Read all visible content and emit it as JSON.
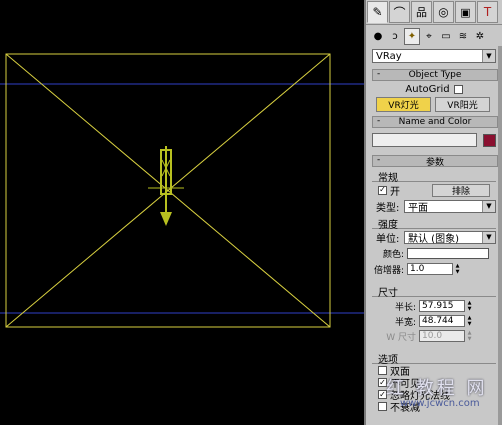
{
  "viewport": {
    "label": "viewport"
  },
  "panel": {
    "tabs": [
      "create-tab",
      "modify-tab",
      "hierarchy-tab",
      "motion-tab",
      "display-tab",
      "utilities-tab"
    ],
    "subtabs": [
      "geometry-icon",
      "shapes-icon",
      "lights-icon",
      "cameras-icon",
      "helpers-icon",
      "spacewarps-icon",
      "systems-icon"
    ],
    "category": "VRay",
    "object_type": {
      "title": "Object Type",
      "sign": "-",
      "autogrid_label": "AutoGrid",
      "buttons": [
        "VR灯光",
        "VR阳光"
      ]
    },
    "name_color": {
      "title": "Name and Color",
      "sign": "-",
      "name_value": "",
      "color": "#8a1030"
    },
    "params": {
      "title": "参数",
      "sign": "-",
      "general": {
        "title": "常规",
        "on_label": "开",
        "on_checked": "✓",
        "exclude_label": "排除",
        "type_label": "类型:",
        "type_value": "平面"
      },
      "intensity": {
        "title": "强度",
        "units_label": "单位:",
        "units_value": "默认 (图象)",
        "color_label": "颜色:",
        "multiplier_label": "倍增器:",
        "multiplier_value": "1.0"
      },
      "size": {
        "title": "尺寸",
        "half_length_label": "半长:",
        "half_length_value": "57.915",
        "half_width_label": "半宽:",
        "half_width_value": "48.744",
        "w_size_label": "W 尺寸",
        "w_size_value": "10.0"
      },
      "options": {
        "title": "选项",
        "items": [
          {
            "checked": "",
            "label": "双面"
          },
          {
            "checked": "✓",
            "label": "不可见"
          },
          {
            "checked": "✓",
            "label": "忽略灯光法线"
          },
          {
            "checked": "",
            "label": "不衰减"
          }
        ]
      }
    }
  },
  "watermark": {
    "title": "红 教程 网",
    "url": "www.jcwcn.com"
  }
}
